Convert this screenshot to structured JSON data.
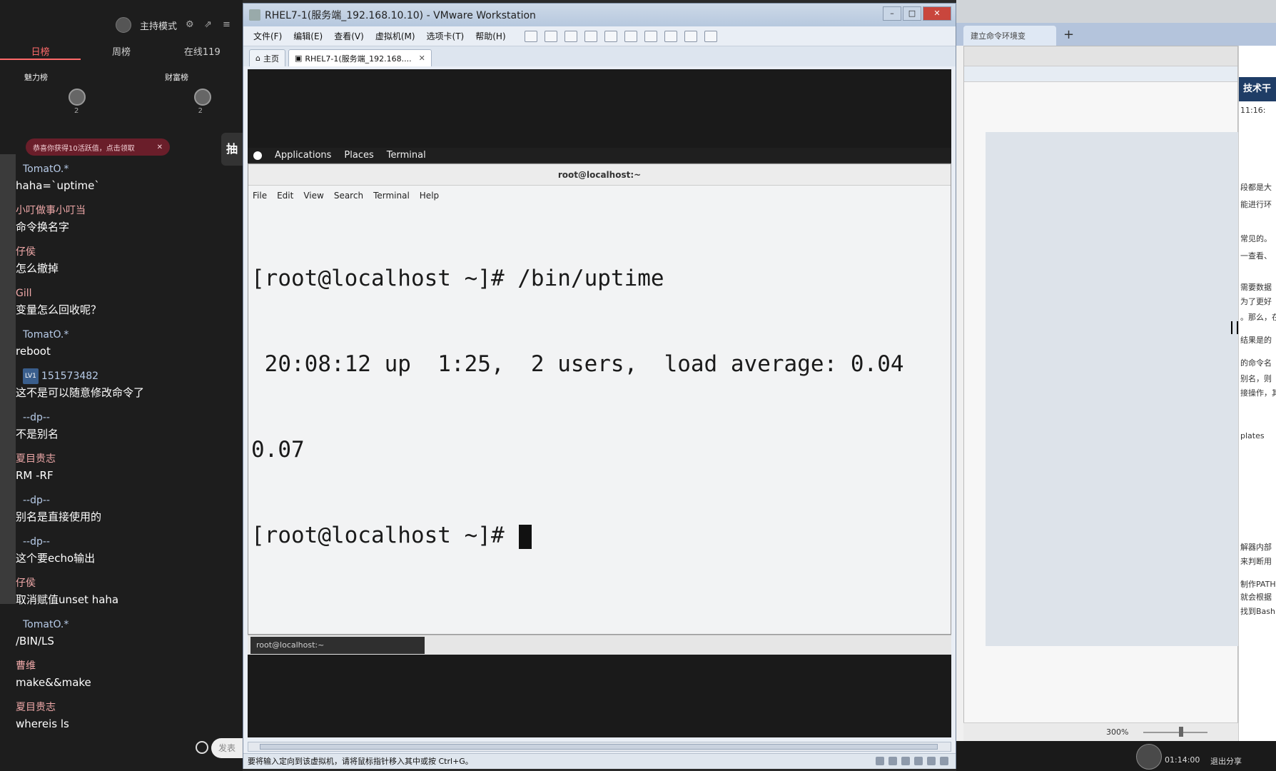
{
  "chat": {
    "host_mode": "主持模式",
    "tabs": [
      "日榜",
      "周榜",
      "在线119"
    ],
    "rank_charm": "魅力榜",
    "rank_wealth": "财富榜",
    "rank_count_1": "2",
    "rank_count_2": "2",
    "notice": "恭喜你获得10活跃值，点击领取",
    "lottery": "抽",
    "input_placeholder": "发表",
    "messages": [
      {
        "user": "TomatO.*",
        "text": "haha=`uptime`"
      },
      {
        "user": "小叮做事小叮当",
        "text": "命令换名字"
      },
      {
        "user": "仔侯",
        "text": "怎么撤掉"
      },
      {
        "user": "Gill",
        "text": "变量怎么回收呢？"
      },
      {
        "user": "TomatO.*",
        "text": "reboot"
      },
      {
        "user": "151573482",
        "level": "LV1",
        "text": "这不是可以随意修改命令了"
      },
      {
        "user": "--dp--",
        "text": "不是别名"
      },
      {
        "user": "夏目贵志",
        "text": "RM -RF"
      },
      {
        "user": "--dp--",
        "text": "别名是直接使用的"
      },
      {
        "user": "--dp--",
        "text": "这个要echo输出"
      },
      {
        "user": "仔侯",
        "text": "取消赋值unset haha"
      },
      {
        "user": "TomatO.*",
        "text": "/BIN/LS"
      },
      {
        "user": "曹维",
        "text": "make&&make"
      },
      {
        "user": "夏目贵志",
        "text": "whereis ls"
      }
    ]
  },
  "vmware": {
    "title": "RHEL7-1(服务端_192.168.10.10) - VMware Workstation",
    "menu": [
      "文件(F)",
      "编辑(E)",
      "查看(V)",
      "虚拟机(M)",
      "选项卡(T)",
      "帮助(H)"
    ],
    "tabs": [
      "主页",
      "RHEL7-1(服务端_192.168...."
    ],
    "status": "要将输入定向到该虚拟机，请将鼠标指针移入其中或按 Ctrl+G。",
    "gnome": {
      "applications": "Applications",
      "places": "Places",
      "terminal": "Terminal"
    },
    "terminal": {
      "title": "root@localhost:~",
      "menu": [
        "File",
        "Edit",
        "View",
        "Search",
        "Terminal",
        "Help"
      ],
      "lines": [
        "[root@localhost ~]# /bin/uptime",
        " 20:08:12 up  1:25,  2 users,  load average: 0.04",
        "0.07",
        "[root@localhost ~]# "
      ]
    },
    "vm_task": "root@localhost:~"
  },
  "background_window": {
    "tab_label": "建立命令环境变",
    "right_head": "技术干",
    "right_time": "11:16:",
    "right_frags": [
      "段都是大",
      "能进行环",
      "常见的。",
      "一查看、",
      "需要数据",
      "为了更好",
      "。那么，在",
      "结果是的",
      "的命令名",
      "别名，则",
      "接操作，其",
      "plates",
      "解器内部",
      "来判断用",
      "制作PATH",
      "就会根据",
      "找到Bash"
    ],
    "zoom": "300%",
    "clock": "01:14:00",
    "exit_share": "退出分享"
  }
}
